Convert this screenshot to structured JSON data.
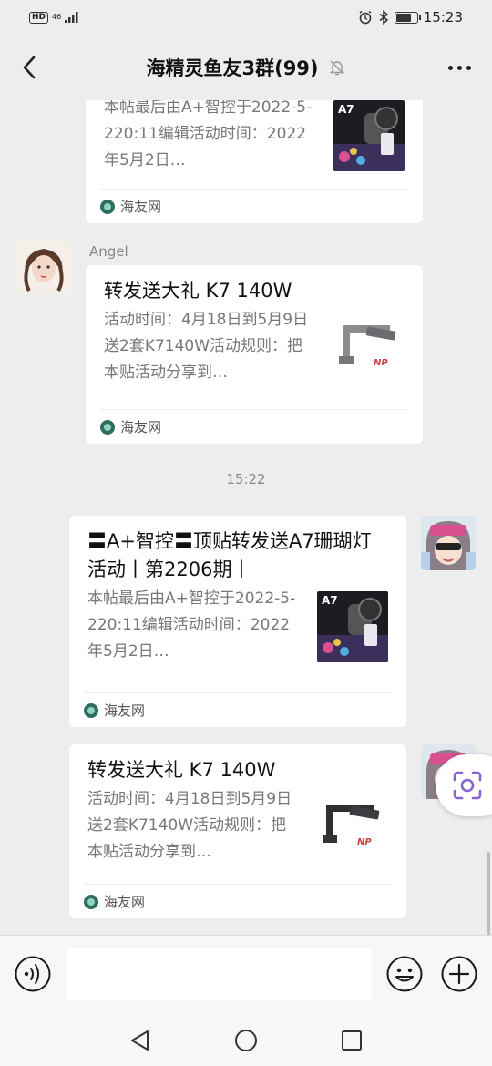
{
  "status_bar": {
    "hd": "HD",
    "network": "46",
    "time": "15:23"
  },
  "header": {
    "title": "海精灵鱼友3群(99)"
  },
  "messages": {
    "card1": {
      "desc": "本帖最后由A+智控于2022-5-220:11编辑活动时间：2022年5月2日…",
      "source": "海友网"
    },
    "angel": {
      "sender": "Angel",
      "title": "转发送大礼 K7 140W",
      "desc": "活动时间：4月18日到5月9日送2套K7140W活动规则：把本贴活动分享到…",
      "source": "海友网"
    },
    "timestamp": "15:22",
    "card3": {
      "title": "〓A+智控〓顶贴转发送A7珊瑚灯活动丨第2206期丨",
      "desc": "本帖最后由A+智控于2022-5-220:11编辑活动时间：2022年5月2日…",
      "source": "海友网"
    },
    "card4": {
      "title": "转发送大礼 K7 140W",
      "desc": "活动时间：4月18日到5月9日送2套K7140W活动规则：把本贴活动分享到…",
      "source": "海友网"
    }
  },
  "thumbs": {
    "a7_label": "A7",
    "np_label": "NP"
  },
  "input": {
    "value": ""
  },
  "icons": {
    "back": "chevron-left-icon",
    "mute": "bell-off-icon",
    "more": "more-horizontal-icon",
    "voice": "voice-icon",
    "emoji": "smile-icon",
    "plus": "plus-circle-icon",
    "lens": "scan-icon"
  },
  "colors": {
    "background": "#ededed",
    "card": "#ffffff",
    "muted_text": "#777777",
    "accent_purple": "#8a63d2"
  }
}
